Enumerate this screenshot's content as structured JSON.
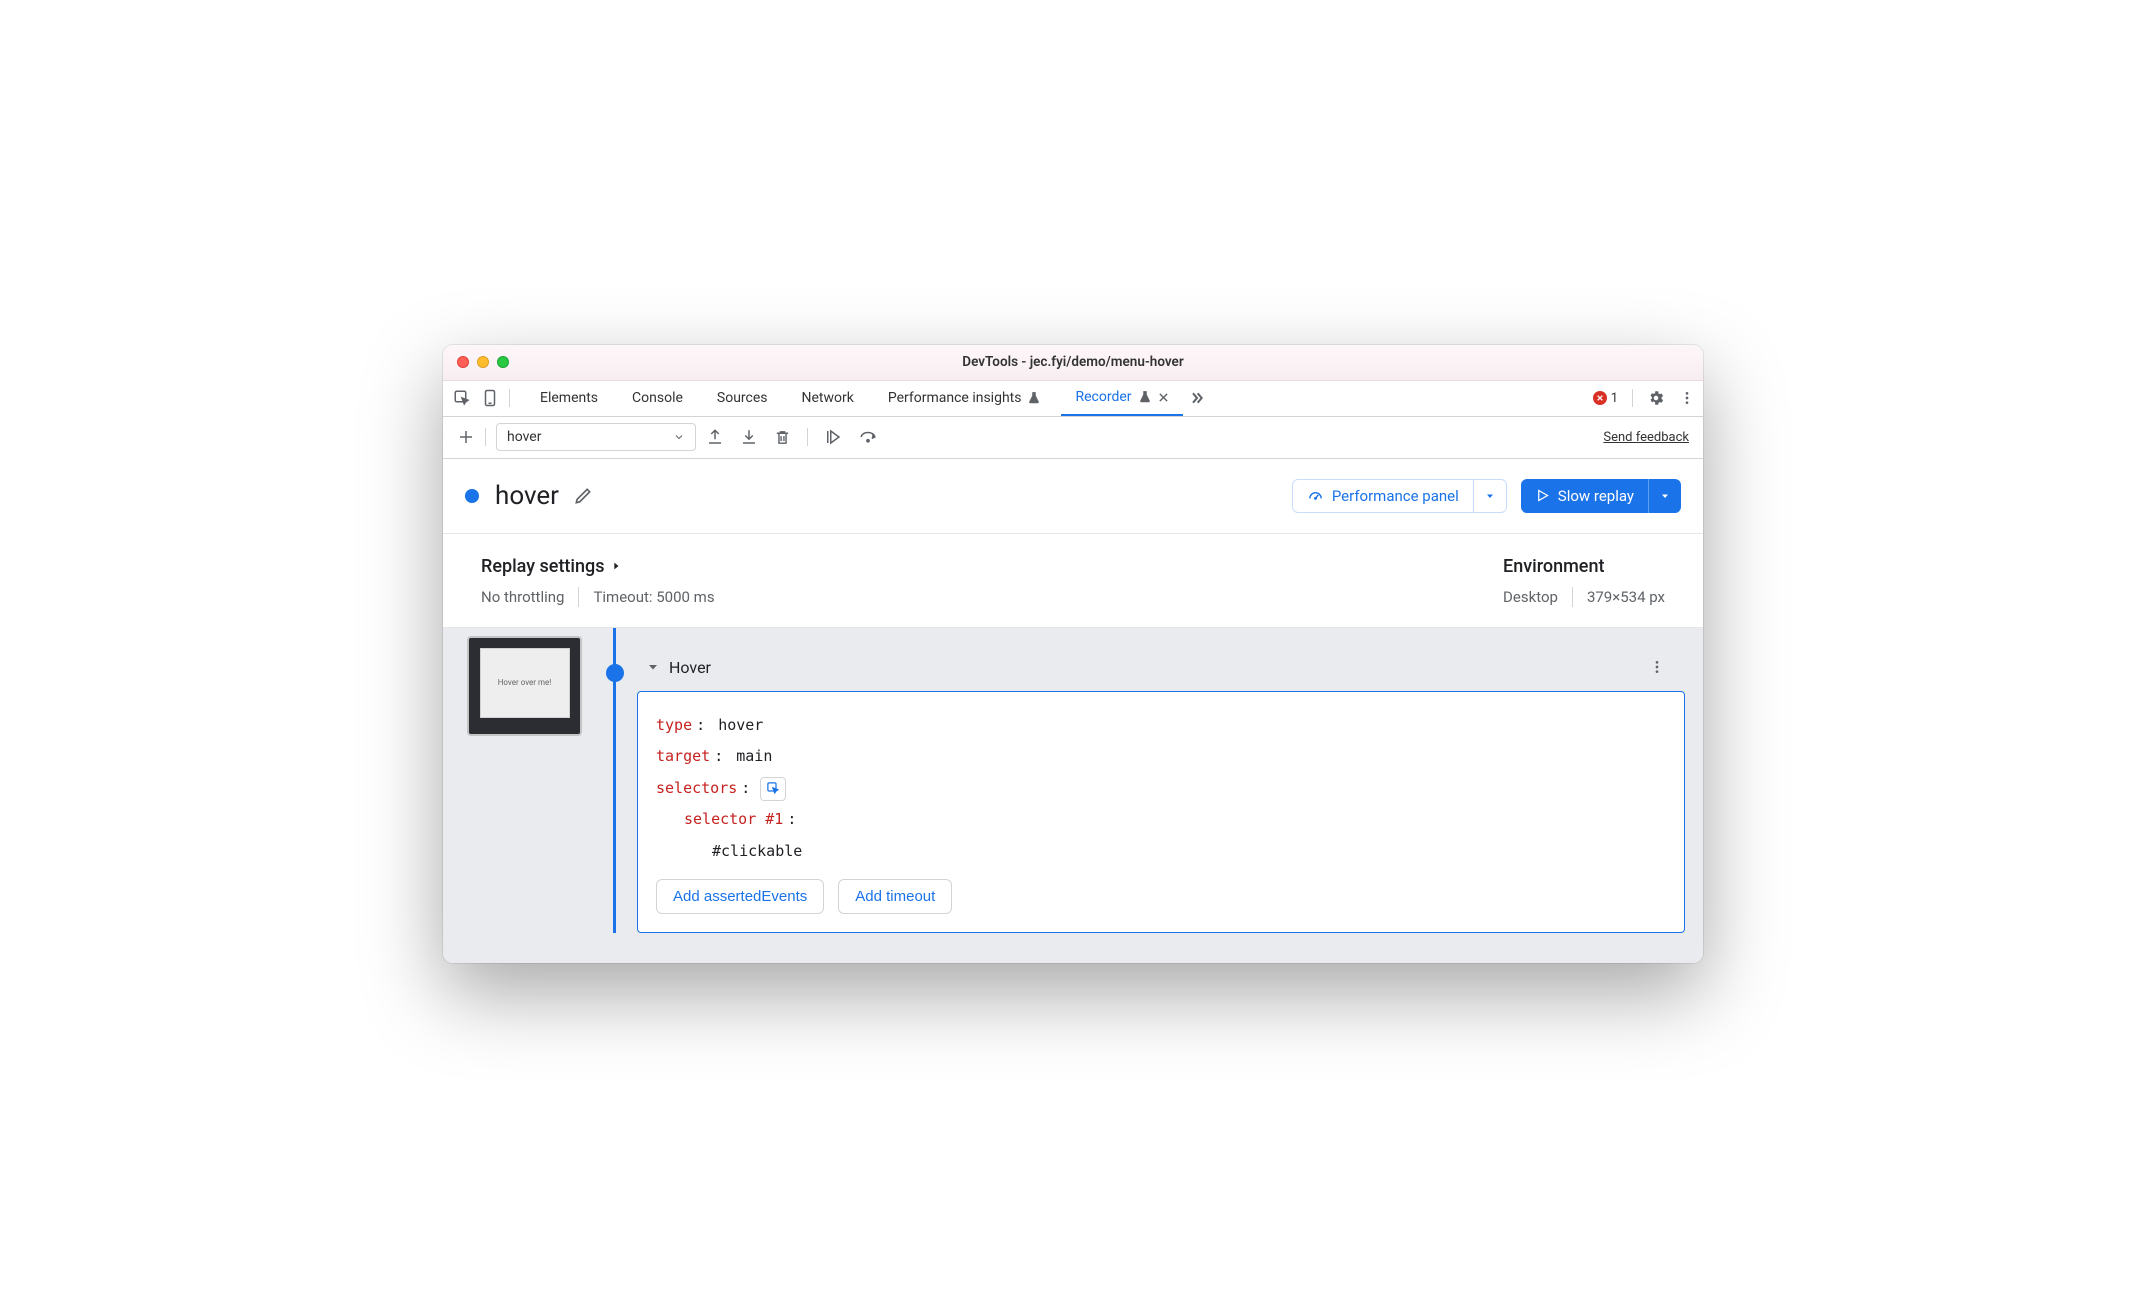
{
  "window": {
    "title": "DevTools - jec.fyi/demo/menu-hover"
  },
  "tabs": {
    "items": [
      "Elements",
      "Console",
      "Sources",
      "Network",
      "Performance insights",
      "Recorder"
    ],
    "active": "Recorder"
  },
  "errors": {
    "count": "1"
  },
  "toolbar": {
    "recording_select": "hover",
    "feedback": "Send feedback"
  },
  "recording": {
    "title": "hover",
    "performance_btn": "Performance panel",
    "replay_btn": "Slow replay"
  },
  "settings": {
    "replay_heading": "Replay settings",
    "throttling": "No throttling",
    "timeout": "Timeout: 5000 ms",
    "env_heading": "Environment",
    "env_device": "Desktop",
    "env_size": "379×534 px"
  },
  "thumbnail": {
    "text": "Hover over me!"
  },
  "step": {
    "label": "Hover",
    "type_key": "type",
    "type_val": "hover",
    "target_key": "target",
    "target_val": "main",
    "selectors_key": "selectors",
    "selector1_key": "selector #1",
    "selector1_val": "#clickable",
    "add_asserted": "Add assertedEvents",
    "add_timeout": "Add timeout"
  }
}
